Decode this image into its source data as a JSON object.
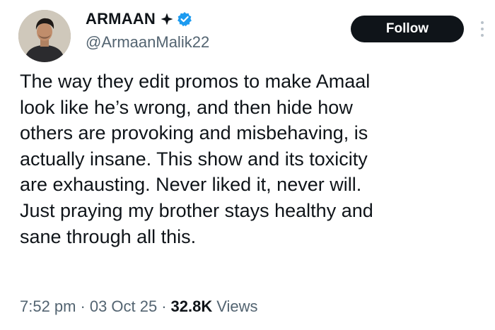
{
  "author": {
    "display_name": "ARMAAN",
    "handle": "@ArmaanMalik22",
    "icons": [
      "star-icon",
      "verified-icon"
    ]
  },
  "actions": {
    "follow_label": "Follow",
    "more_icon": "more-icon"
  },
  "tweet": {
    "lines": [
      "The way they edit promos to make Amaal",
      "look like he’s wrong, and then hide how",
      "others are provoking and misbehaving, is",
      "actually insane. This show and its toxicity",
      "are exhausting. Never liked it, never will.",
      "Just praying my brother stays healthy and",
      "sane through all this."
    ]
  },
  "meta": {
    "time": "7:52 pm",
    "separator": "·",
    "date": "03 Oct 25",
    "views_count": "32.8K",
    "views_label": "Views"
  },
  "colors": {
    "text": "#0f1419",
    "secondary": "#536471",
    "verified": "#1d9bf0",
    "follow_bg": "#0f1419",
    "follow_text": "#ffffff"
  }
}
